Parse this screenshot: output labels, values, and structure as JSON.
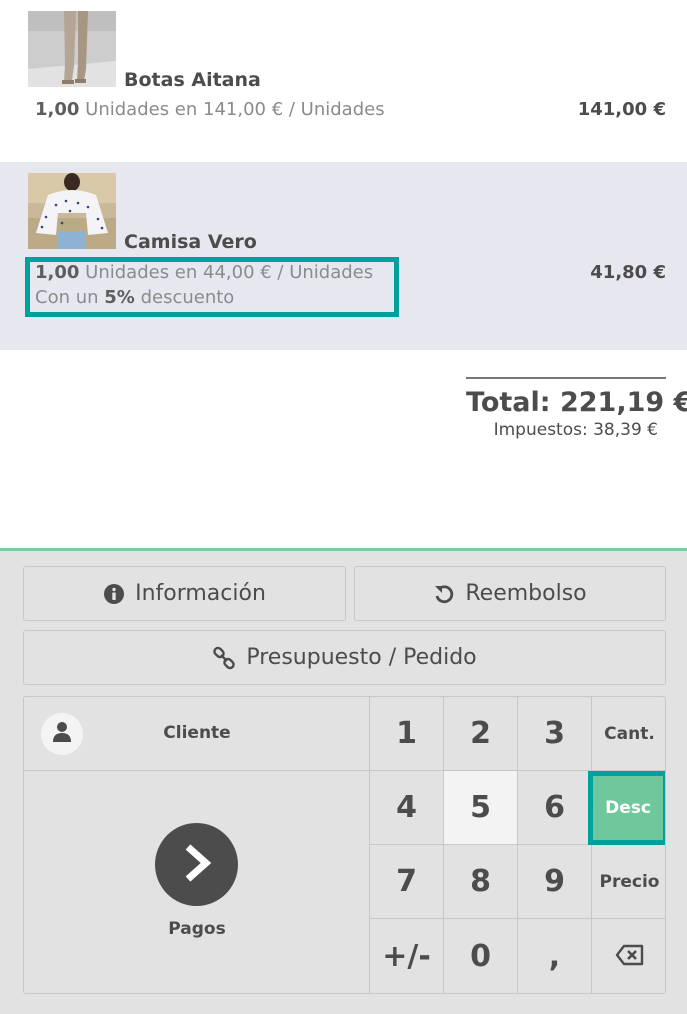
{
  "order": {
    "lines": [
      {
        "name": "Botas Aitana",
        "qty": "1,00",
        "unit_text": "Unidades en 141,00 € / Unidades",
        "price": "141,00 €"
      },
      {
        "name": "Camisa Vero",
        "qty": "1,00",
        "unit_text": "Unidades en 44,00 € / Unidades",
        "discount_prefix": "Con un",
        "discount_value": "5%",
        "discount_suffix": "descuento",
        "price": "41,80 €"
      }
    ],
    "total": "Total: 221,19 €",
    "taxes": "Impuestos: 38,39 €"
  },
  "controls": {
    "info_label": "Información",
    "refund_label": "Reembolso",
    "quote_label": "Presupuesto / Pedido",
    "customer_label": "Cliente",
    "payment_label": "Pagos"
  },
  "numpad": {
    "keys": [
      "1",
      "2",
      "3",
      "4",
      "5",
      "6",
      "7",
      "8",
      "9",
      "+/-",
      "0",
      ","
    ],
    "modes": [
      "Cant.",
      "Desc",
      "Precio"
    ],
    "active_mode": "Desc",
    "active_key": "5"
  },
  "colors": {
    "accent_teal": "#00a09d",
    "active_mode_green": "#6ec89b",
    "panel_border": "#7ecba1",
    "selected_line_bg": "#e6e7ef"
  },
  "icons": {
    "info": "info-circle-icon",
    "refund": "undo-icon",
    "quote": "link-icon",
    "customer": "user-icon",
    "payment": "chevron-right-icon",
    "backspace": "backspace-icon"
  }
}
